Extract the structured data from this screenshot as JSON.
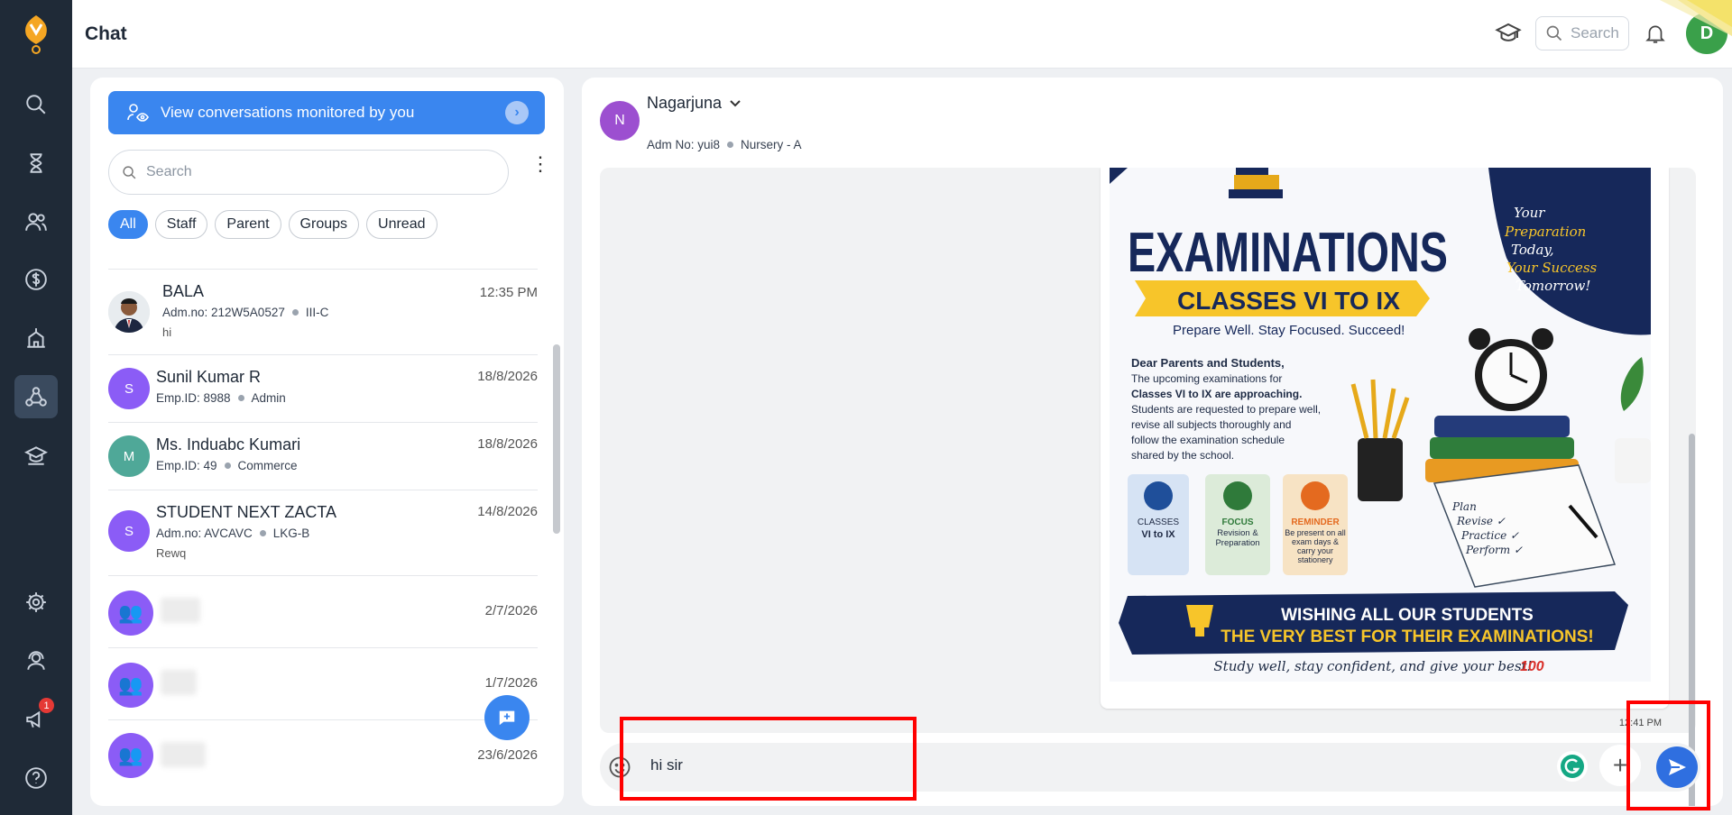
{
  "app": {
    "title": "Chat",
    "notifications_badge": "1"
  },
  "topbar": {
    "search_placeholder": "Search",
    "avatar_initial": "D"
  },
  "left": {
    "monitor_label": "View conversations monitored by you",
    "search_placeholder": "Search",
    "filters": [
      "All",
      "Staff",
      "Parent",
      "Groups",
      "Unread"
    ],
    "conversations": [
      {
        "name": "BALA",
        "id": "Adm.no: 212W5A0527",
        "tag": "III-C",
        "message": "hi",
        "time": "12:35 PM"
      },
      {
        "initial": "S",
        "name": "Sunil Kumar R",
        "id": "Emp.ID: 8988",
        "tag": "Admin",
        "time": "18/8/2026"
      },
      {
        "initial": "M",
        "name": "Ms. Induabc Kumari",
        "id": "Emp.ID: 49",
        "tag": "Commerce",
        "time": "18/8/2026"
      },
      {
        "initial": "S",
        "name": "STUDENT NEXT ZACTA",
        "id": "Adm.no: AVCAVC",
        "tag": "LKG-B",
        "message": "Rewq",
        "time": "14/8/2026"
      },
      {
        "time": "2/7/2026"
      },
      {
        "time": "1/7/2026"
      },
      {
        "time": "23/6/2026"
      }
    ]
  },
  "chat": {
    "contact_initial": "N",
    "contact_name": "Nagarjuna",
    "adm_no": "Adm No: yui8",
    "class": "Nursery - A",
    "composer_text": "hi sir",
    "message_time": "12:41 PM",
    "poster": {
      "title": "EXAMINATIONS",
      "banner": "CLASSES VI TO IX",
      "tagline": "Prepare Well. Stay Focused. Succeed!",
      "corner_lines": [
        "Your",
        "Preparation",
        "Today,",
        "Your Success",
        "Tomorrow!"
      ],
      "greeting": "Dear Parents and Students,",
      "body_lines": [
        "The upcoming examinations for",
        "Classes VI to IX are approaching.",
        "Students are requested to prepare well,",
        "revise all subjects thoroughly and",
        "follow the examination schedule",
        "shared by the school."
      ],
      "cards": [
        {
          "title": "CLASSES",
          "text": "VI to IX"
        },
        {
          "title": "FOCUS",
          "text": "Revision & Preparation"
        },
        {
          "title": "REMINDER",
          "text": "Be present on all exam days & carry your stationery"
        }
      ],
      "notebook_lines": [
        "Plan",
        "Revise ✓",
        "Practice ✓",
        "Perform ✓"
      ],
      "wish_line1": "WISHING ALL OUR STUDENTS",
      "wish_line2": "THE VERY BEST FOR THEIR EXAMINATIONS!",
      "footer": "Study well, stay confident, and give your best!",
      "footer_mark": "100"
    }
  },
  "colors": {
    "primary": "#3a86ef",
    "sidebar": "#1f2a37",
    "avatar_purple": "#8b5cf6",
    "avatar_teal": "#4fa898",
    "highlight": "#ff0000"
  }
}
